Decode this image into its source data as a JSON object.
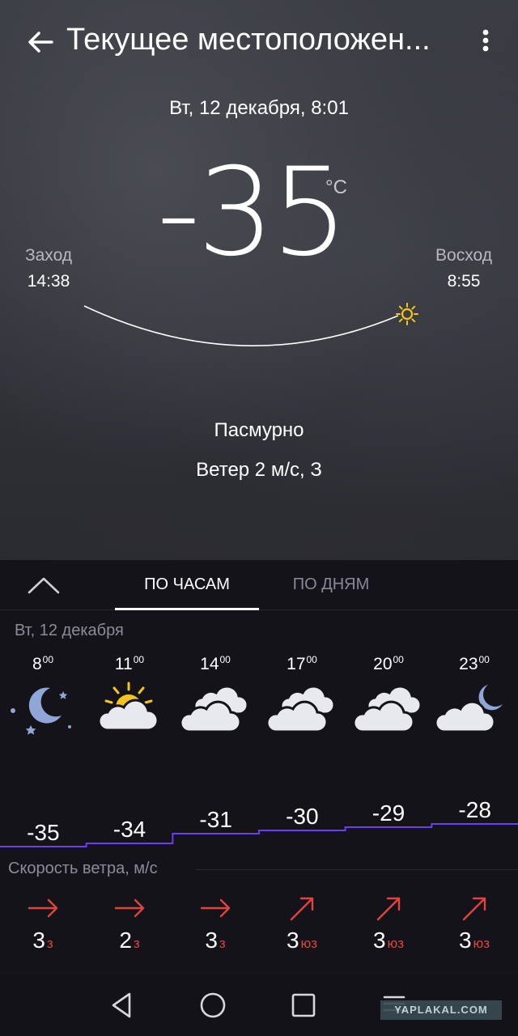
{
  "header": {
    "title": "Текущее местоположен..."
  },
  "current": {
    "datetime": "Вт, 12 декабря, 8:01",
    "temperature": "-35",
    "unit": "°C",
    "sunset_label": "Заход",
    "sunset_time": "14:38",
    "sunrise_label": "Восход",
    "sunrise_time": "8:55",
    "condition": "Пасмурно",
    "wind": "Ветер 2 м/с, З"
  },
  "tabs": {
    "hours": "ПО ЧАСАМ",
    "days": "ПО ДНЯМ",
    "active": "hours"
  },
  "forecast": {
    "day_label": "Вт, 12 декабря",
    "hours": [
      {
        "hour": "8",
        "minutes": "00",
        "icon": "night-clear-moon-icon",
        "temp": "-35",
        "wind_speed": "3",
        "wind_dir": "з"
      },
      {
        "hour": "11",
        "minutes": "00",
        "icon": "sun-behind-cloud-icon",
        "temp": "-34",
        "wind_speed": "2",
        "wind_dir": "з"
      },
      {
        "hour": "14",
        "minutes": "00",
        "icon": "overcast-cloud-icon",
        "temp": "-31",
        "wind_speed": "3",
        "wind_dir": "з"
      },
      {
        "hour": "17",
        "minutes": "00",
        "icon": "overcast-cloud-icon",
        "temp": "-30",
        "wind_speed": "3",
        "wind_dir": "юз"
      },
      {
        "hour": "20",
        "minutes": "00",
        "icon": "overcast-cloud-icon",
        "temp": "-29",
        "wind_speed": "3",
        "wind_dir": "юз"
      },
      {
        "hour": "23",
        "minutes": "00",
        "icon": "moon-behind-cloud-icon",
        "temp": "-28",
        "wind_speed": "3",
        "wind_dir": "юз"
      }
    ],
    "wind_title": "Скорость ветра, м/с"
  },
  "watermark": "YAPLAKAL.COM",
  "colors": {
    "accent_line": "#6b3df0",
    "wind_arrow": "#e0443c",
    "sun": "#f5c518"
  }
}
